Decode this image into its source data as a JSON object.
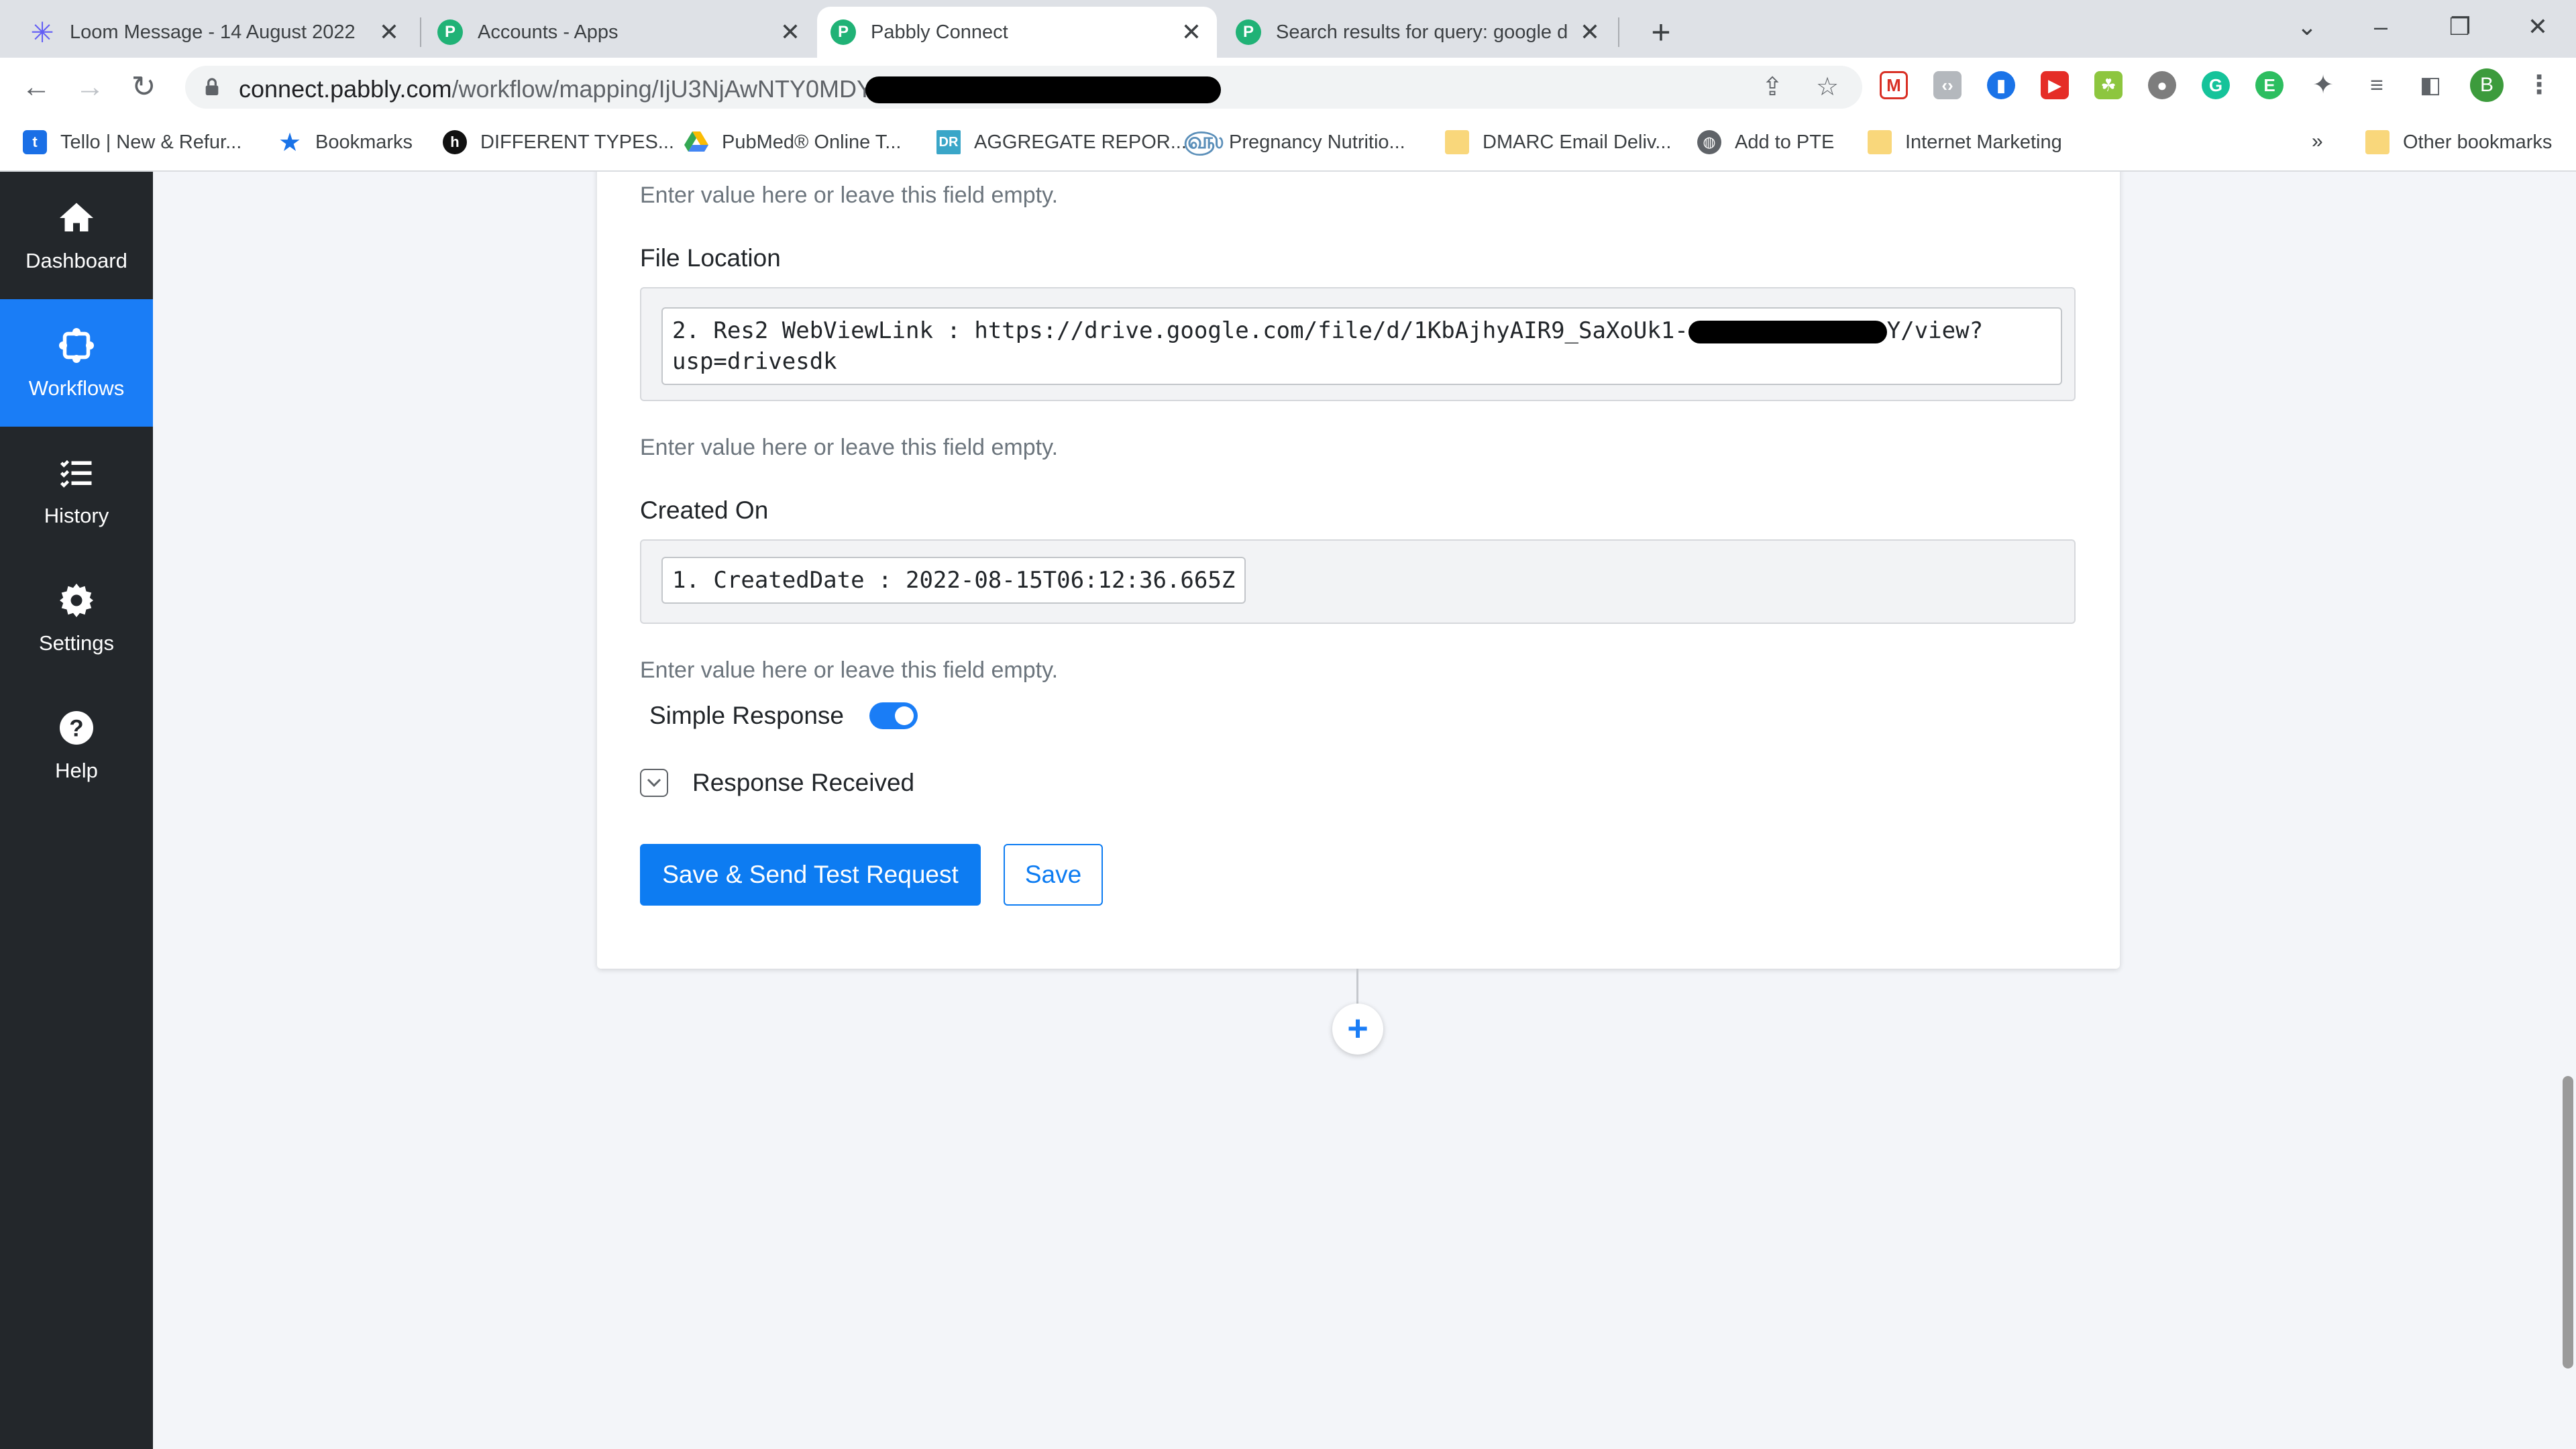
{
  "browser": {
    "tabs": [
      {
        "title": "Loom Message - 14 August 2022",
        "favicon": "loom-icon",
        "active": false
      },
      {
        "title": "Accounts - Apps",
        "favicon": "pabbly-icon",
        "active": false
      },
      {
        "title": "Pabbly Connect",
        "favicon": "pabbly-icon",
        "active": true
      },
      {
        "title": "Search results for query: google d",
        "favicon": "pabbly-icon",
        "active": false
      }
    ],
    "new_tab_label": "+",
    "url_host": "connect.pabbly.com",
    "url_path": "/workflow/mapping/IjU3NjAwNTY0MDYzMDA",
    "profile_initial": "B",
    "bookmarks": [
      {
        "label": "Tello | New & Refur...",
        "icon": "tello-icon"
      },
      {
        "label": "Bookmarks",
        "icon": "star-icon"
      },
      {
        "label": "DIFFERENT TYPES...",
        "icon": "h-logo-icon"
      },
      {
        "label": "PubMed® Online T...",
        "icon": "google-drive-icon"
      },
      {
        "label": "AGGREGATE REPOR...",
        "icon": "dr-icon"
      },
      {
        "label": "Pregnancy Nutritio...",
        "icon": "spiral-icon"
      },
      {
        "label": "DMARC Email Deliv...",
        "icon": "folder-icon"
      },
      {
        "label": "Add to PTE",
        "icon": "globe-icon"
      },
      {
        "label": "Internet Marketing",
        "icon": "folder-icon"
      }
    ],
    "more_bookmarks": "»",
    "other_bookmarks": "Other bookmarks"
  },
  "sidebar": {
    "items": [
      {
        "label": "Dashboard",
        "icon": "home-icon",
        "active": false
      },
      {
        "label": "Workflows",
        "icon": "workflow-icon",
        "active": true
      },
      {
        "label": "History",
        "icon": "history-list-icon",
        "active": false
      },
      {
        "label": "Settings",
        "icon": "gear-icon",
        "active": false
      },
      {
        "label": "Help",
        "icon": "help-icon",
        "active": false
      }
    ]
  },
  "form": {
    "top_hint": "Enter value here or leave this field empty.",
    "file_location": {
      "label": "File Location",
      "value_line1": "2. Res2 WebViewLink : https://drive.google.com/file/d/1KbAjhyAIR9_SaXoUk1-",
      "value_line1_end": "Y/view?",
      "value_line2": "usp=drivesdk",
      "hint": "Enter value here or leave this field empty."
    },
    "created_on": {
      "label": "Created On",
      "value": "1. CreatedDate : 2022-08-15T06:12:36.665Z",
      "hint": "Enter value here or leave this field empty."
    },
    "simple_response": {
      "label": "Simple Response",
      "enabled": true
    },
    "response_received": {
      "label": "Response Received"
    },
    "buttons": {
      "save_and_test": "Save & Send Test Request",
      "save": "Save"
    },
    "add_step": "+"
  },
  "colors": {
    "primary": "#0d7cf2",
    "sidebar_bg": "#23272b",
    "sidebar_active": "#1a7df6",
    "pabbly_green": "#20b276"
  }
}
